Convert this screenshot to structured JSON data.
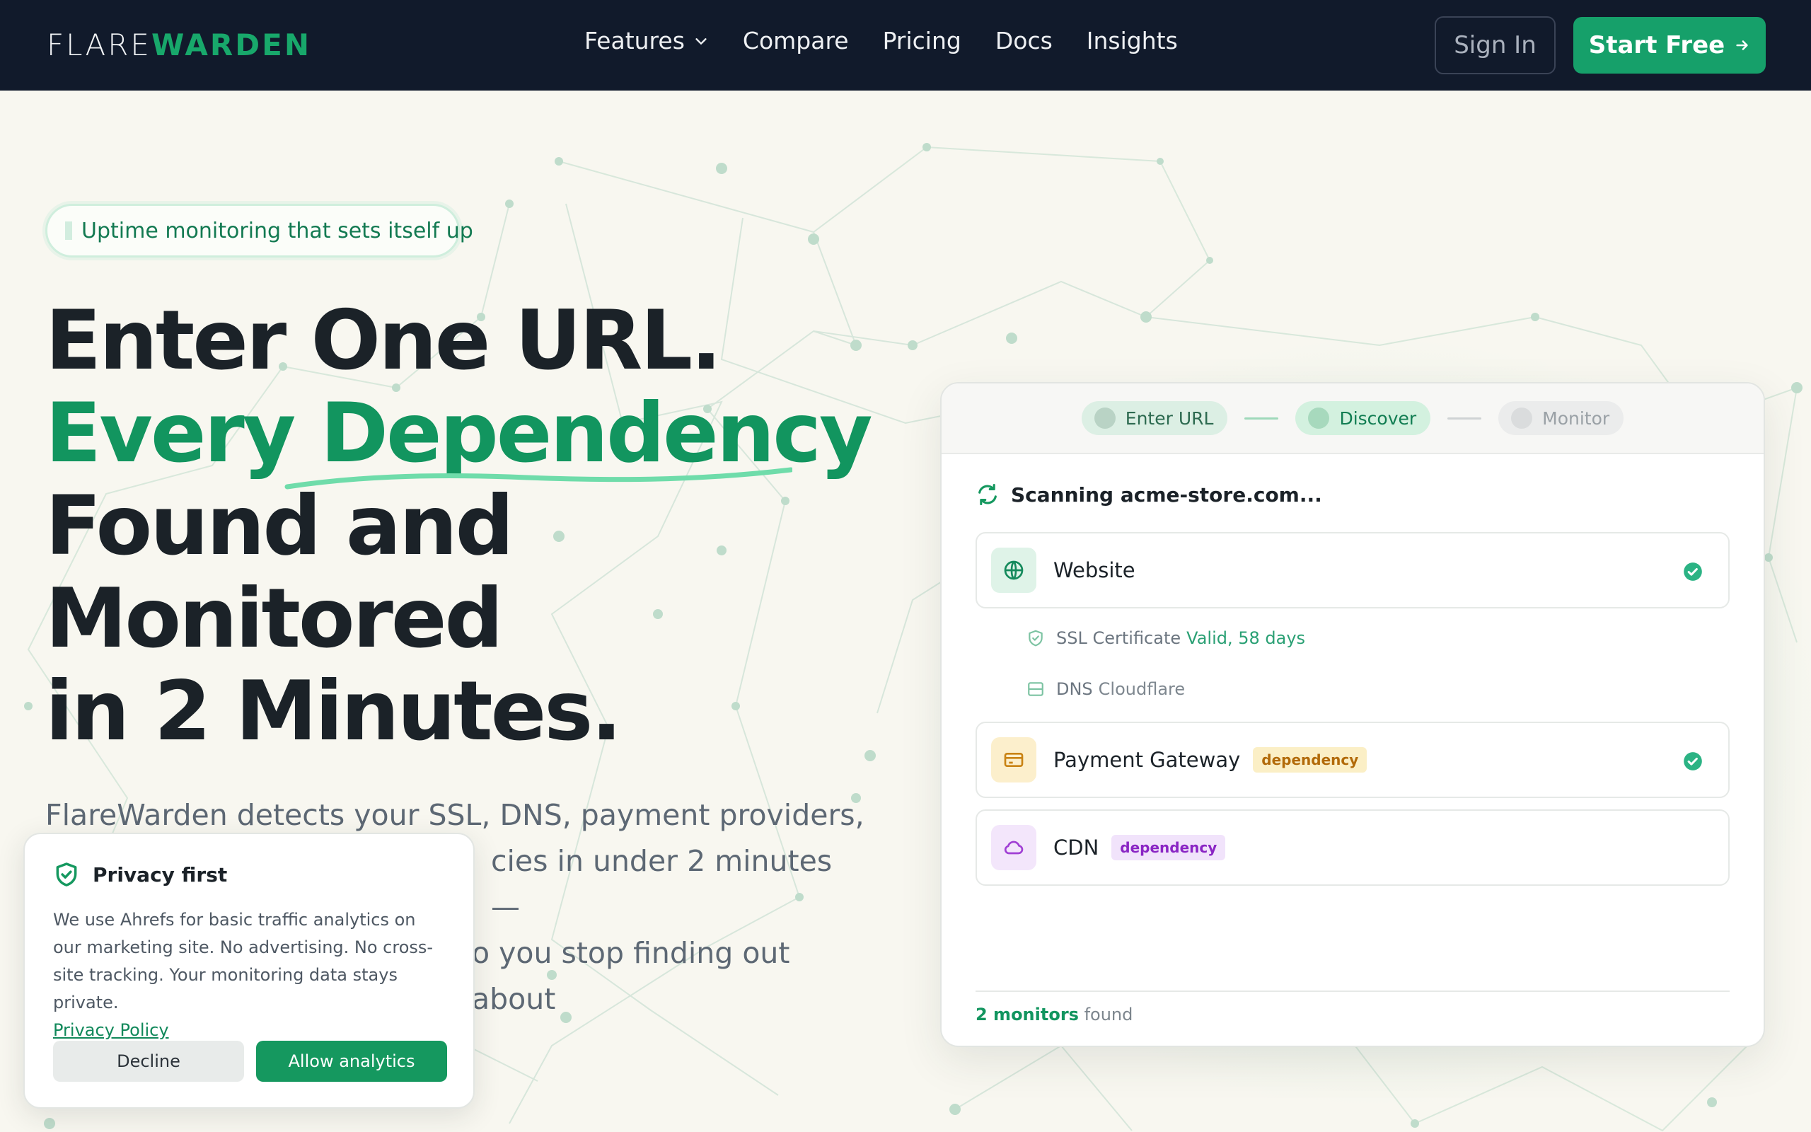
{
  "brand": {
    "part1": "FLARE",
    "part2": "WARDEN"
  },
  "nav": {
    "links": [
      "Features",
      "Compare",
      "Pricing",
      "Docs",
      "Insights"
    ],
    "sign_in": "Sign In",
    "cta": "Start Free"
  },
  "hero": {
    "pill": "Uptime monitoring that sets itself up",
    "line1": "Enter One URL.",
    "line2": "Every Dependency",
    "line3": "Found and",
    "line4": "Monitored",
    "line5": "in 2 Minutes.",
    "sub_line1": "FlareWarden detects your SSL, DNS, payment providers,",
    "sub_line2": "cies in under 2 minutes —",
    "sub_line3": "o you stop finding out about"
  },
  "privacy": {
    "title": "Privacy first",
    "body": "We use Ahrefs for basic traffic analytics on our marketing site. No advertising. No cross-site tracking. Your monitoring data stays private.",
    "link": "Privacy Policy",
    "decline": "Decline",
    "allow": "Allow analytics"
  },
  "scan": {
    "steps": [
      "Enter URL",
      "Discover",
      "Monitor"
    ],
    "title": "Scanning acme-store.com...",
    "items": [
      {
        "name": "Website",
        "badge": "",
        "checked": true,
        "icon": "globe-icon"
      },
      {
        "name": "Payment Gateway",
        "badge": "dependency",
        "checked": true,
        "icon": "credit-card-icon"
      },
      {
        "name": "CDN",
        "badge": "dependency",
        "checked": false,
        "icon": "cloud-icon"
      }
    ],
    "ssl": {
      "label": "SSL Certificate",
      "value": "Valid, 58 days"
    },
    "dns": {
      "label": "DNS",
      "value": "Cloudflare"
    },
    "footer_count": "2 monitors",
    "footer_text": " found"
  },
  "colors": {
    "nav_bg": "#111a2b",
    "accent": "#16a06a",
    "headline_green": "#12955f"
  }
}
